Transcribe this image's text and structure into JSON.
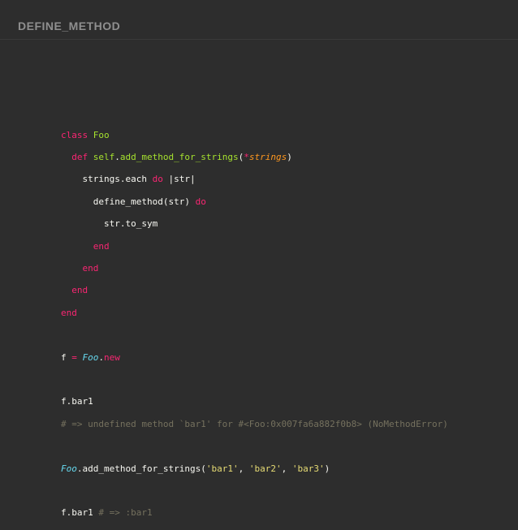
{
  "slide": {
    "title": "DEFINE_METHOD"
  },
  "code": {
    "l1_kw": "class",
    "l1_name": "Foo",
    "l2_kw": "def",
    "l2_self": "self",
    "l2_dot": ".",
    "l2_method": "add_method_for_strings",
    "l2_open": "(",
    "l2_splat": "*",
    "l2_param": "strings",
    "l2_close": ")",
    "l3_text": "strings.each",
    "l3_kw": "do",
    "l3_block": "|str|",
    "l4_text": "define_method(str)",
    "l4_kw": "do",
    "l5_text": "str.to_sym",
    "l6_kw": "end",
    "l7_kw": "end",
    "l8_kw": "end",
    "l9_kw": "end",
    "l11_var": "f",
    "l11_eq": "=",
    "l11_cls": "Foo",
    "l11_dot": ".",
    "l11_new": "new",
    "l13_text": "f.bar1",
    "l14_comment": "# => undefined method `bar1' for #<Foo:0x007fa6a882f0b8> (NoMethodError)",
    "l16_cls": "Foo",
    "l16_call": ".add_method_for_strings(",
    "l16_s1": "'bar1'",
    "l16_c1": ", ",
    "l16_s2": "'bar2'",
    "l16_c2": ", ",
    "l16_s3": "'bar3'",
    "l16_close": ")",
    "l18_text": "f.bar1",
    "l18_comment": "# => :bar1"
  }
}
